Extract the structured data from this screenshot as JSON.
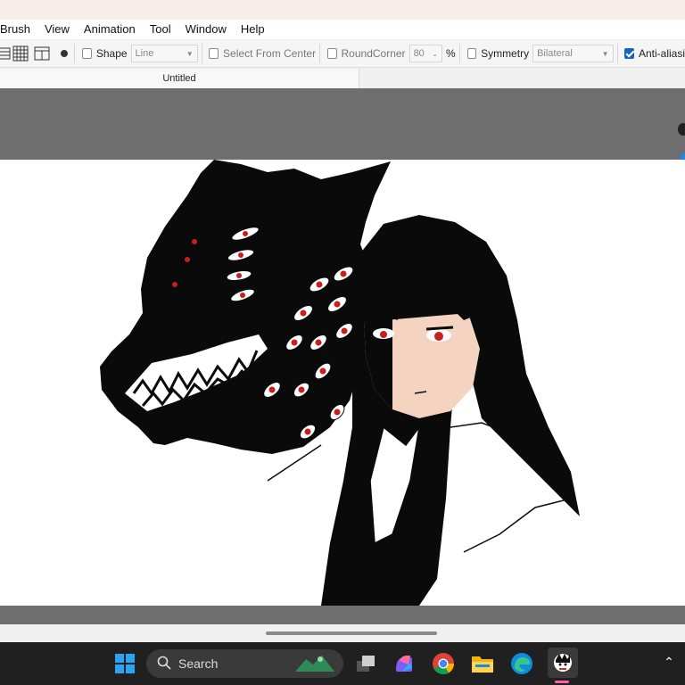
{
  "menu": [
    "Brush",
    "View",
    "Animation",
    "Tool",
    "Window",
    "Help"
  ],
  "toolbar": {
    "shape_label": "Shape",
    "shape_value": "Line",
    "select_from_center_label": "Select From Center",
    "roundcorner_label": "RoundCorner",
    "roundcorner_value": "80",
    "percent": "%",
    "symmetry_label": "Symmetry",
    "symmetry_value": "Bilateral",
    "antialias_label": "Anti-aliasi"
  },
  "tab": {
    "title": "Untitled"
  },
  "taskbar": {
    "search_placeholder": "Search",
    "icons": [
      "windows-start-icon",
      "search-icon",
      "task-view-icon",
      "copilot-icon",
      "chrome-icon",
      "file-explorer-icon",
      "edge-icon",
      "medibang-icon",
      "chevron-up-icon"
    ]
  },
  "colors": {
    "workspace": "#6e6e6e",
    "canvas": "#ffffff",
    "accent": "#1565c0",
    "taskbar": "#202020",
    "eye_red": "#c81e1e"
  }
}
